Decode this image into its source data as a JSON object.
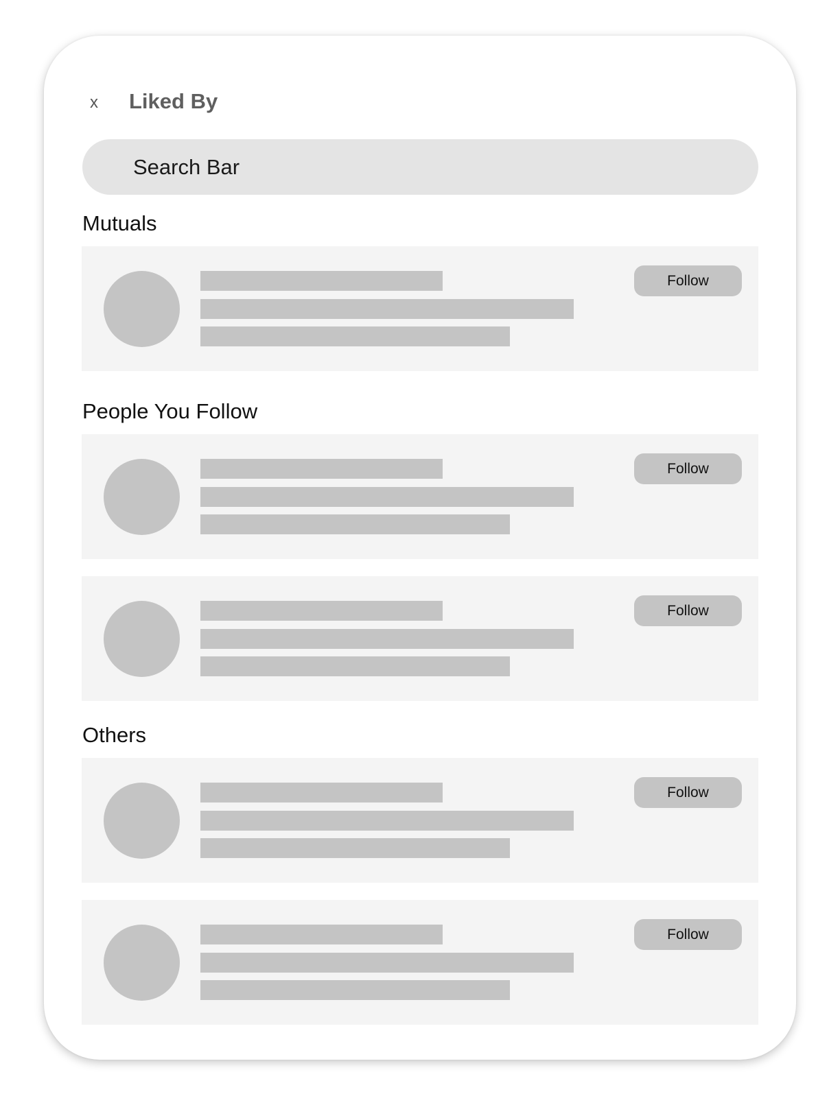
{
  "header": {
    "close_label": "x",
    "title": "Liked By"
  },
  "search": {
    "label": "Search Bar"
  },
  "sections": [
    {
      "heading": "Mutuals",
      "rows": [
        {
          "follow_label": "Follow"
        }
      ]
    },
    {
      "heading": "People You Follow",
      "rows": [
        {
          "follow_label": "Follow"
        },
        {
          "follow_label": "Follow"
        }
      ]
    },
    {
      "heading": "Others",
      "rows": [
        {
          "follow_label": "Follow"
        },
        {
          "follow_label": "Follow"
        }
      ]
    }
  ]
}
